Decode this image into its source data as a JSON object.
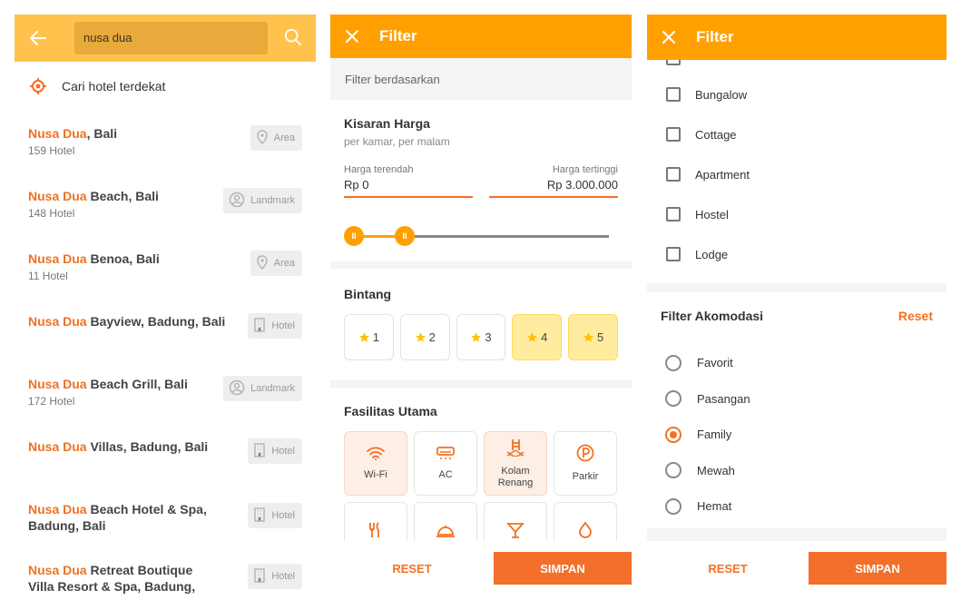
{
  "search": {
    "query": "nusa dua",
    "nearby_label": "Cari hotel terdekat"
  },
  "results": [
    {
      "hl": "Nusa Dua",
      "rest": ", Bali",
      "sub": "159 Hotel",
      "badge": "Area",
      "icon": "map-pin-icon"
    },
    {
      "hl": "Nusa Dua",
      "rest": " Beach, Bali",
      "sub": "148 Hotel",
      "badge": "Landmark",
      "icon": "landmark-icon"
    },
    {
      "hl": "Nusa Dua",
      "rest": " Benoa, Bali",
      "sub": "11 Hotel",
      "badge": "Area",
      "icon": "map-pin-icon"
    },
    {
      "hl": "Nusa Dua",
      "rest": " Bayview, Badung, Bali",
      "sub": "",
      "badge": "Hotel",
      "icon": "building-icon"
    },
    {
      "hl": "Nusa Dua",
      "rest": " Beach Grill, Bali",
      "sub": "172 Hotel",
      "badge": "Landmark",
      "icon": "landmark-icon"
    },
    {
      "hl": "Nusa Dua",
      "rest": " Villas, Badung, Bali",
      "sub": "",
      "badge": "Hotel",
      "icon": "building-icon"
    },
    {
      "hl": "Nusa Dua",
      "rest": " Beach Hotel & Spa, Badung, Bali",
      "sub": "",
      "badge": "Hotel",
      "icon": "building-icon"
    },
    {
      "hl": "Nusa Dua",
      "rest": " Retreat Boutique Villa Resort & Spa, Badung, Bali",
      "sub": "",
      "badge": "Hotel",
      "icon": "building-icon"
    }
  ],
  "filter": {
    "title": "Filter",
    "section_label": "Filter berdasarkan",
    "price": {
      "title": "Kisaran Harga",
      "subtitle": "per kamar, per malam",
      "min_label": "Harga terendah",
      "min_value": "Rp 0",
      "max_label": "Harga tertinggi",
      "max_value": "Rp 3.000.000",
      "knob_glyph": "II"
    },
    "stars": {
      "title": "Bintang",
      "options": [
        {
          "label": "1",
          "selected": false
        },
        {
          "label": "2",
          "selected": false
        },
        {
          "label": "3",
          "selected": false
        },
        {
          "label": "4",
          "selected": true
        },
        {
          "label": "5",
          "selected": true
        }
      ]
    },
    "facilities": {
      "title": "Fasilitas Utama",
      "items": [
        {
          "label": "Wi-Fi",
          "icon": "wifi-icon",
          "selected": true
        },
        {
          "label": "AC",
          "icon": "air-conditioner-icon",
          "selected": false
        },
        {
          "label": "Kolam Renang",
          "icon": "pool-icon",
          "selected": true
        },
        {
          "label": "Parkir",
          "icon": "parking-icon",
          "selected": false
        },
        {
          "label": "",
          "icon": "restaurant-icon",
          "selected": false
        },
        {
          "label": "",
          "icon": "room-service-icon",
          "selected": false
        },
        {
          "label": "",
          "icon": "bar-icon",
          "selected": false
        },
        {
          "label": "",
          "icon": "spa-icon",
          "selected": false
        }
      ]
    },
    "reset_label": "RESET",
    "save_label": "SIMPAN"
  },
  "property_types": [
    "Bungalow",
    "Cottage",
    "Apartment",
    "Hostel",
    "Lodge"
  ],
  "accommodation": {
    "title": "Filter Akomodasi",
    "reset_label": "Reset",
    "options": [
      {
        "label": "Favorit",
        "selected": false
      },
      {
        "label": "Pasangan",
        "selected": false
      },
      {
        "label": "Family",
        "selected": true
      },
      {
        "label": "Mewah",
        "selected": false
      },
      {
        "label": "Hemat",
        "selected": false
      }
    ]
  },
  "colors": {
    "accent": "#f37022",
    "header": "#ffa000",
    "search_bar": "#ffc24d",
    "star": "#ffc107"
  }
}
